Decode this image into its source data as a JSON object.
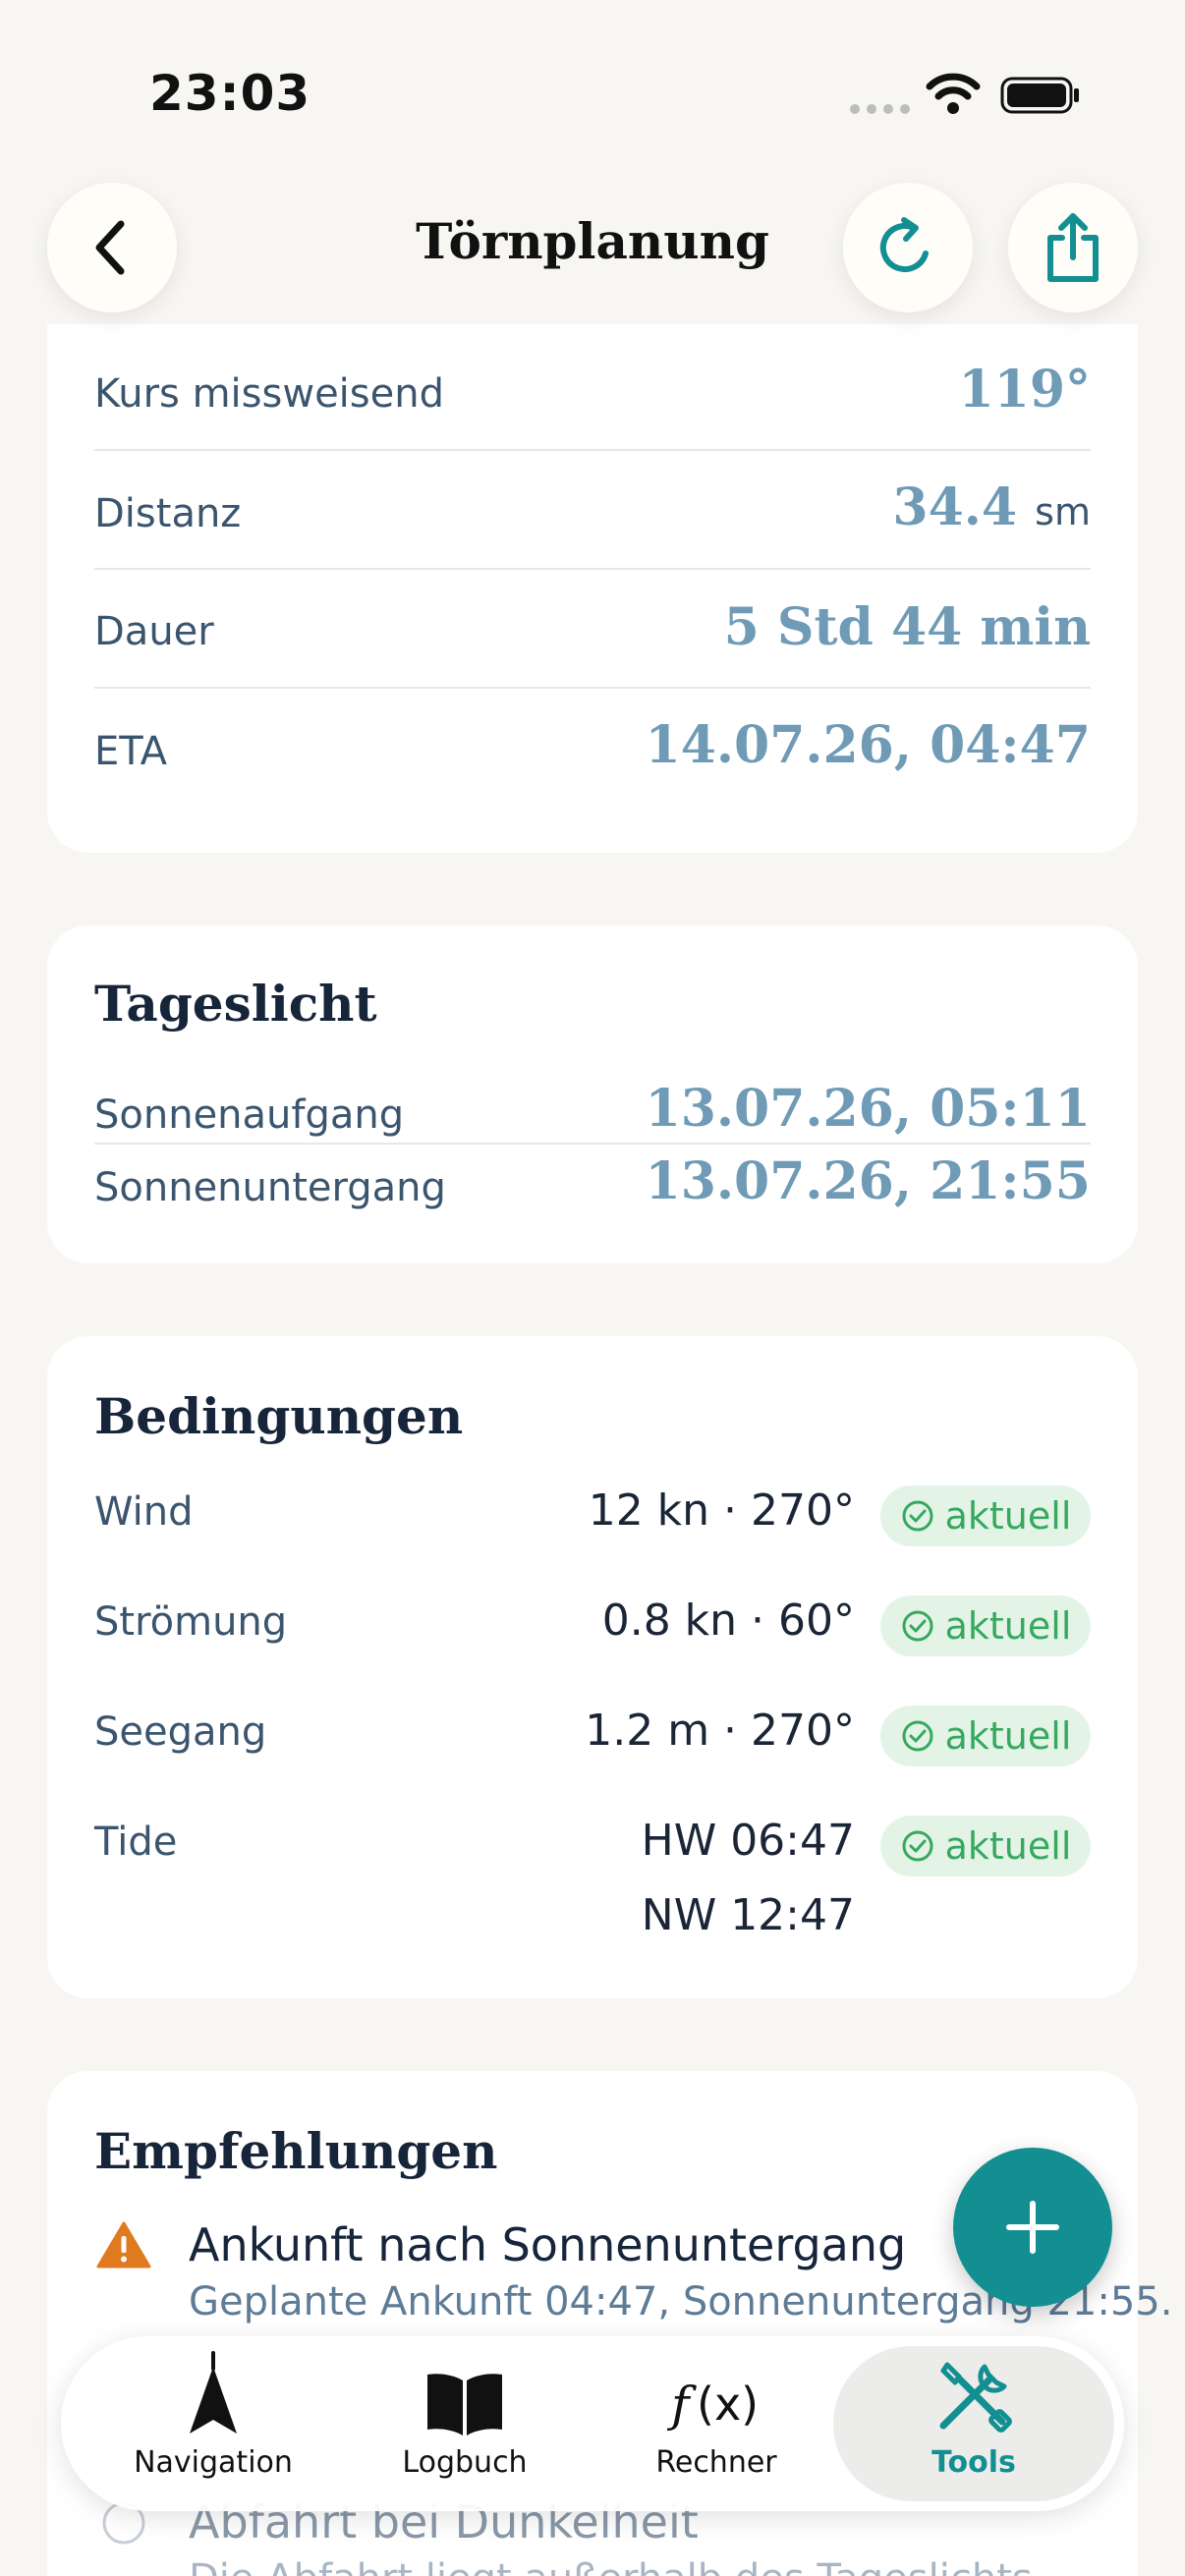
{
  "status_bar": {
    "time": "23:03"
  },
  "header": {
    "title": "Törnplanung"
  },
  "route": {
    "rows": [
      {
        "label": "Kurs missweisend",
        "value": "119°",
        "unit": ""
      },
      {
        "label": "Distanz",
        "value": "34.4",
        "unit": "sm"
      },
      {
        "label": "Dauer",
        "value": "5 Std 44 min",
        "unit": ""
      },
      {
        "label": "ETA",
        "value": "14.07.26, 04:47",
        "unit": ""
      }
    ]
  },
  "daylight": {
    "title": "Tageslicht",
    "rows": [
      {
        "label": "Sonnenaufgang",
        "value": "13.07.26, 05:11"
      },
      {
        "label": "Sonnenuntergang",
        "value": "13.07.26, 21:55"
      }
    ]
  },
  "conditions": {
    "title": "Bedingungen",
    "rows": [
      {
        "label": "Wind",
        "value": "12 kn · 270°",
        "badge": "aktuell"
      },
      {
        "label": "Strömung",
        "value": "0.8 kn · 60°",
        "badge": "aktuell"
      },
      {
        "label": "Seegang",
        "value": "1.2 m · 270°",
        "badge": "aktuell"
      },
      {
        "label": "Tide",
        "value": "HW 06:47",
        "value2": "NW 12:47",
        "badge": "aktuell"
      }
    ]
  },
  "recommendations": {
    "title": "Empfehlungen",
    "items": [
      {
        "title": "Ankunft nach Sonnenuntergang",
        "text": "Geplante Ankunft 04:47, Sonnenuntergang 21:55."
      },
      {
        "title": "Abfahrt bei Dunkelheit",
        "text": "Die Abfahrt liegt außerhalb des Tageslichts."
      }
    ]
  },
  "tabbar": {
    "tabs": [
      {
        "label": "Navigation",
        "icon": "navigation-arrow-icon"
      },
      {
        "label": "Logbuch",
        "icon": "book-icon"
      },
      {
        "label": "Rechner",
        "icon": "function-icon"
      },
      {
        "label": "Tools",
        "icon": "tools-icon"
      }
    ],
    "active": "Tools"
  },
  "colors": {
    "accent": "#138f92",
    "value_blue": "#6f9bb6",
    "badge_green": "#37a860",
    "warning_orange": "#e07a1f"
  }
}
